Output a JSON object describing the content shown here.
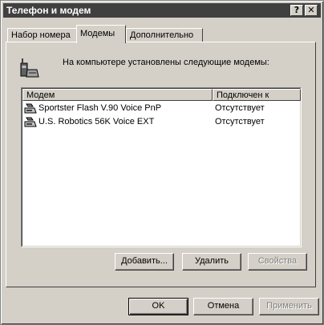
{
  "window": {
    "title": "Телефон и модем",
    "help_button": "?",
    "close_button": "✕"
  },
  "tabs": [
    {
      "label": "Набор номера",
      "active": false
    },
    {
      "label": "Модемы",
      "active": true
    },
    {
      "label": "Дополнительно",
      "active": false
    }
  ],
  "panel": {
    "intro_text": "На компьютере установлены следующие модемы:",
    "icon": "modem-phone-icon"
  },
  "modem_list": {
    "columns": [
      "Модем",
      "Подключен к"
    ],
    "rows": [
      {
        "name": "Sportster Flash V.90 Voice PnP",
        "connected": "Отсутствует",
        "icon": "modem-icon"
      },
      {
        "name": "U.S. Robotics 56K Voice EXT",
        "connected": "Отсутствует",
        "icon": "modem-icon"
      }
    ]
  },
  "panel_buttons": {
    "add": "Добавить...",
    "delete": "Удалить",
    "properties": "Свойства"
  },
  "dialog_buttons": {
    "ok": "OK",
    "cancel": "Отмена",
    "apply": "Применить"
  }
}
